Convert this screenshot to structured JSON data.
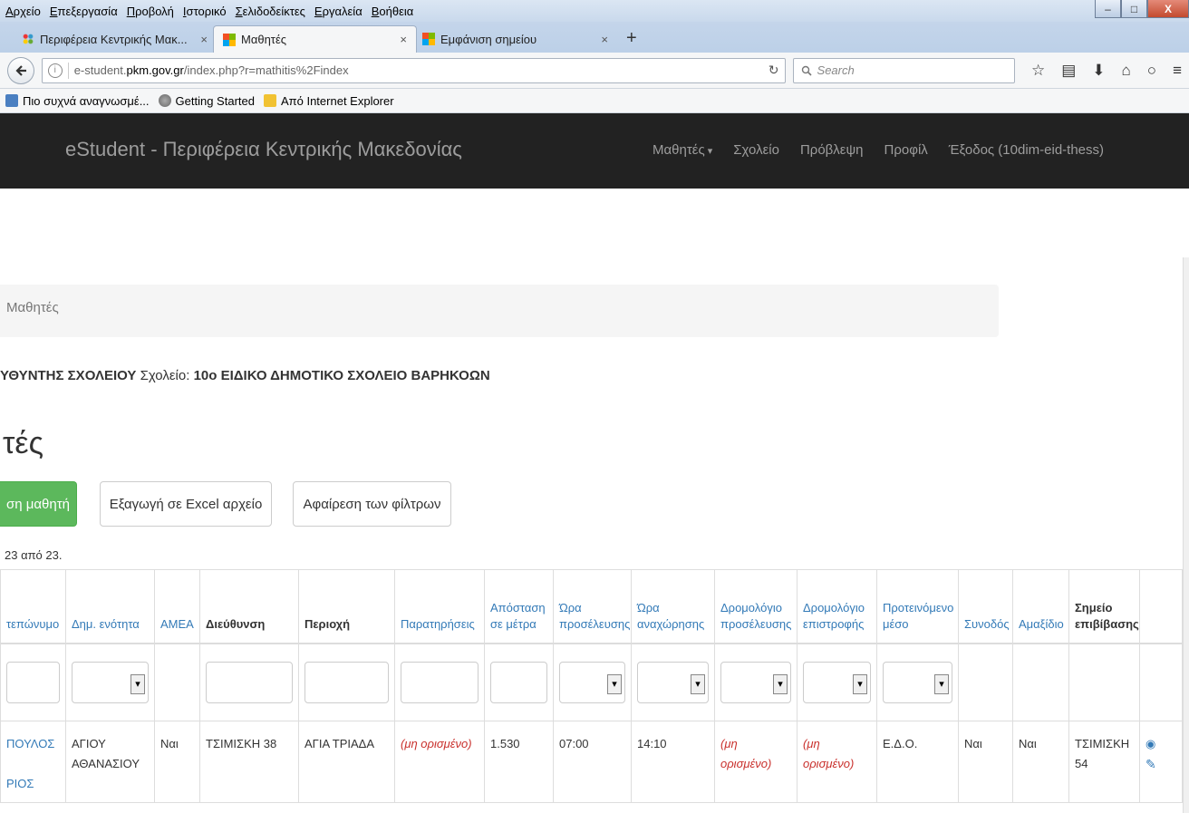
{
  "browser": {
    "menu": [
      "Αρχείο",
      "Επεξεργασία",
      "Προβολή",
      "Ιστορικό",
      "Σελιδοδείκτες",
      "Εργαλεία",
      "Βοήθεια"
    ],
    "window_buttons": {
      "minimize": "–",
      "maximize": "□",
      "close": "X"
    },
    "tabs": [
      {
        "label": "Περιφέρεια Κεντρικής Μακ...",
        "close": "×",
        "active": false
      },
      {
        "label": "Μαθητές",
        "close": "×",
        "active": true
      },
      {
        "label": "Εμφάνιση σημείου",
        "close": "×",
        "active": false
      }
    ],
    "new_tab": "+",
    "url_prefix": "e-student.",
    "url_domain": "pkm.gov.gr",
    "url_path": "/index.php?r=mathitis%2Findex",
    "search_placeholder": "Search",
    "bookmarks": [
      "Πιο συχνά αναγνωσμέ...",
      "Getting Started",
      "Από Internet Explorer"
    ]
  },
  "site": {
    "brand": "eStudent - Περιφέρεια Κεντρικής Μακεδονίας",
    "menu": [
      "Μαθητές",
      "Σχολείο",
      "Πρόβλεψη",
      "Προφίλ",
      "Έξοδος (10dim-eid-thess)"
    ]
  },
  "page": {
    "breadcrumb": "Μαθητές",
    "director_role": "ΥΘΥΝΤΗΣ ΣΧΟΛΕΙΟΥ",
    "school_label": "Σχολείο:",
    "school_name": "10ο ΕΙΔΙΚΟ ΔΗΜΟΤΙΚΟ ΣΧΟΛΕΙΟ ΒΑΡΗΚΟΩΝ",
    "title": "τές",
    "add_button": "ση μαθητή",
    "export_button": "Εξαγωγή σε Excel αρχείο",
    "clear_filters_button": "Αφαίρεση των φίλτρων",
    "summary": "23 από 23."
  },
  "table": {
    "columns": [
      {
        "label": "τεπώνυμο",
        "sortable": true
      },
      {
        "label": "Δημ. ενότητα",
        "sortable": true
      },
      {
        "label": "ΑΜΕΑ",
        "sortable": true
      },
      {
        "label": "Διεύθυνση",
        "sortable": false
      },
      {
        "label": "Περιοχή",
        "sortable": false
      },
      {
        "label": "Παρατηρήσεις",
        "sortable": true
      },
      {
        "label": "Απόσταση σε μέτρα",
        "sortable": true
      },
      {
        "label": "Ώρα προσέλευσης",
        "sortable": true
      },
      {
        "label": "Ώρα αναχώρησης",
        "sortable": true
      },
      {
        "label": "Δρομολόγιο προσέλευσης",
        "sortable": true
      },
      {
        "label": "Δρομολόγιο επιστροφής",
        "sortable": true
      },
      {
        "label": "Προτεινόμενο μέσο",
        "sortable": true
      },
      {
        "label": "Συνοδός",
        "sortable": true
      },
      {
        "label": "Αμαξίδιο",
        "sortable": true
      },
      {
        "label": "Σημείο επιβίβασης",
        "sortable": false
      }
    ],
    "row": {
      "surname": "ΠΟΥΛΟΣ",
      "first_name": "ΡΙΟΣ",
      "district": "ΑΓΙΟΥ ΑΘΑΝΑΣΙΟΥ",
      "amea": "Ναι",
      "address": "ΤΣΙΜΙΣΚΗ 38",
      "area": "ΑΓΙΑ ΤΡΙΑΔΑ",
      "notes": "(μη ορισμένο)",
      "distance": "1.530",
      "arrival": "07:00",
      "departure": "14:10",
      "route_arrival": "(μη ορισμένο)",
      "route_return": "(μη ορισμένο)",
      "transport": "Ε.Δ.Ο.",
      "escort": "Ναι",
      "wheelchair": "Ναι",
      "pickup": "ΤΣΙΜΙΣΚΗ 54"
    }
  }
}
